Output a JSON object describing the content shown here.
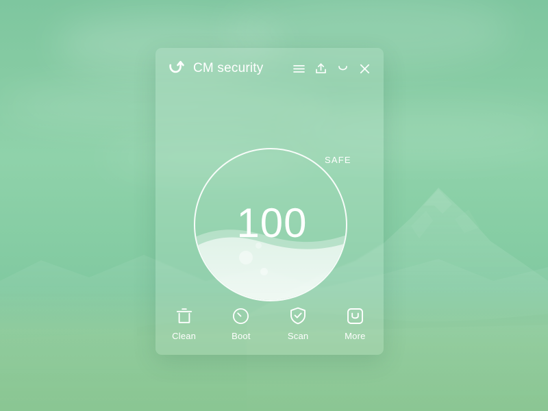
{
  "window": {
    "title": "CM security",
    "logo_icon": "cm-security-swoosh-arrow-logo",
    "controls": [
      {
        "name": "menu",
        "icon": "hamburger-menu-icon",
        "label": "Menu"
      },
      {
        "name": "share",
        "icon": "upload-share-icon",
        "label": "Share"
      },
      {
        "name": "minimize",
        "icon": "minimize-icon",
        "label": "Minimize"
      },
      {
        "name": "close",
        "icon": "close-x-icon",
        "label": "Close"
      }
    ]
  },
  "gauge": {
    "score": "100",
    "status_label": "SAFE",
    "fill_percent": 58,
    "ring_color": "#ffffff",
    "water_color": "#d9f0e4"
  },
  "toolbar": {
    "items": [
      {
        "label": "Clean",
        "icon": "trash-can-icon"
      },
      {
        "label": "Boot",
        "icon": "speedometer-clock-icon"
      },
      {
        "label": "Scan",
        "icon": "shield-check-icon"
      },
      {
        "label": "More",
        "icon": "rounded-square-smile-icon"
      }
    ]
  },
  "theme": {
    "background_top": "#7ec69f",
    "background_mid": "#8fd2aa",
    "background_bottom": "#79c29a",
    "panel_tint": "rgba(255,255,255,0.13)",
    "text_color": "#ffffff"
  },
  "background": {
    "scene": "green-tinted-mountain-landscape-photo"
  }
}
